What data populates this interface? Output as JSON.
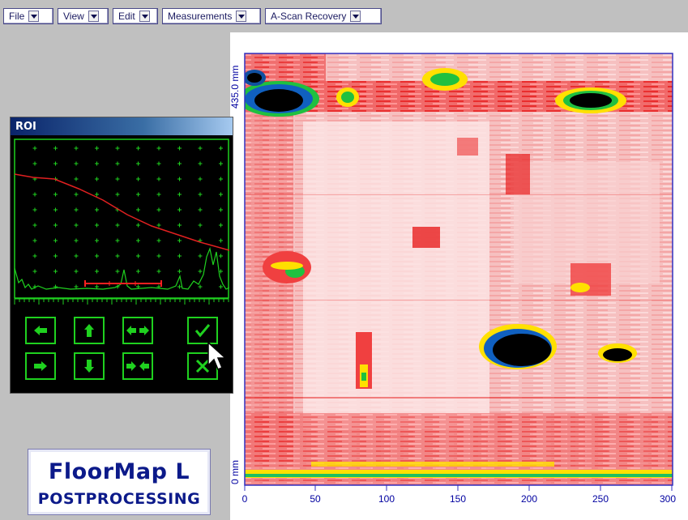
{
  "menu": [
    {
      "label": "File"
    },
    {
      "label": "View"
    },
    {
      "label": "Edit"
    },
    {
      "label": "Measurements"
    },
    {
      "label": "A-Scan Recovery"
    }
  ],
  "roi_window": {
    "title": "ROI",
    "buttons": [
      {
        "name": "move-left-button",
        "icon": "arrow-left-icon"
      },
      {
        "name": "move-up-button",
        "icon": "arrow-up-icon"
      },
      {
        "name": "expand-button",
        "icon": "expand-horizontal-icon"
      },
      {
        "name": "confirm-button",
        "icon": "checkmark-icon"
      },
      {
        "name": "move-right-button",
        "icon": "arrow-right-icon"
      },
      {
        "name": "move-down-button",
        "icon": "arrow-down-icon"
      },
      {
        "name": "shrink-button",
        "icon": "shrink-horizontal-icon"
      },
      {
        "name": "cancel-button",
        "icon": "cross-icon"
      }
    ]
  },
  "logo": {
    "line1": "FloorMap L",
    "line2": "POSTPROCESSING"
  },
  "cscan": {
    "x_ticks": [
      "0",
      "50",
      "100",
      "150",
      "200",
      "250",
      "300"
    ],
    "y_top_label": "435.0 mm",
    "y_bottom_label": "0 mm"
  },
  "colors": {
    "accent": "#1fd11f",
    "gate": "#ff2020",
    "axis": "#0000a0",
    "defect": "#000000"
  }
}
